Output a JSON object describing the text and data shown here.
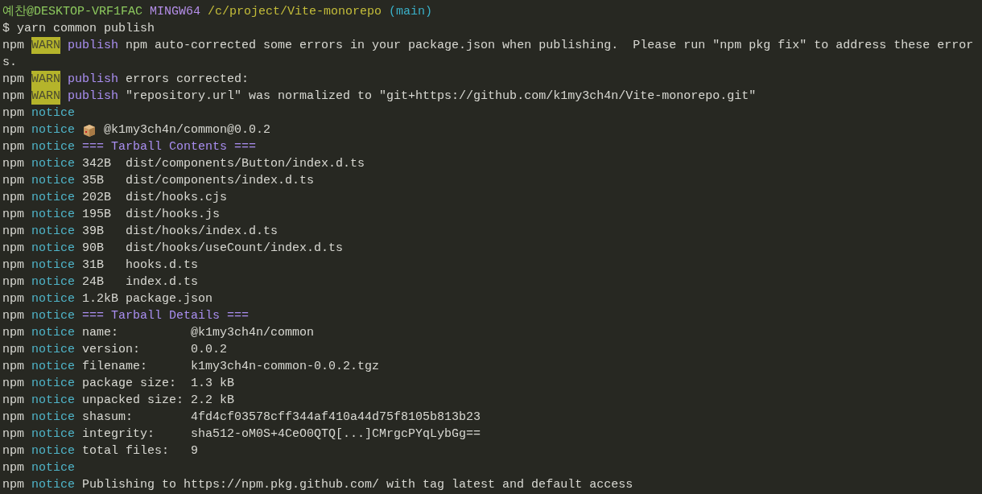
{
  "terminal": {
    "lines": [
      [
        {
          "kind": "user",
          "text": "예찬@DESKTOP-VRF1FAC"
        },
        {
          "kind": "system",
          "text": "MINGW64"
        },
        {
          "kind": "path",
          "text": "/c/project/Vite-monorepo"
        },
        {
          "kind": "branch",
          "text": "(main)"
        }
      ],
      [
        {
          "kind": "prompt",
          "text": "$"
        },
        {
          "kind": "command",
          "text": "yarn common publish"
        }
      ],
      [
        {
          "kind": "prefix",
          "text": "npm"
        },
        {
          "kind": "warn",
          "text": "WARN"
        },
        {
          "kind": "title",
          "text": "publish"
        },
        {
          "kind": "message",
          "text": "npm auto-corrected some errors in your package.json when publishing.  Please run \"npm pkg fix\" to address these error"
        }
      ],
      [
        {
          "kind": "message",
          "text": "s."
        }
      ],
      [
        {
          "kind": "prefix",
          "text": "npm"
        },
        {
          "kind": "warn",
          "text": "WARN"
        },
        {
          "kind": "title",
          "text": "publish"
        },
        {
          "kind": "message",
          "text": "errors corrected:"
        }
      ],
      [
        {
          "kind": "prefix",
          "text": "npm"
        },
        {
          "kind": "warn",
          "text": "WARN"
        },
        {
          "kind": "title",
          "text": "publish"
        },
        {
          "kind": "message",
          "text": "\"repository.url\" was normalized to \"git+https://github.com/k1my3ch4n/Vite-monorepo.git\""
        }
      ],
      [
        {
          "kind": "prefix",
          "text": "npm"
        },
        {
          "kind": "level",
          "text": "notice"
        }
      ],
      [
        {
          "kind": "prefix",
          "text": "npm"
        },
        {
          "kind": "level",
          "text": "notice"
        },
        {
          "kind": "package-icon"
        },
        {
          "kind": "message",
          "text": "@k1my3ch4n/common@0.0.2"
        }
      ],
      [
        {
          "kind": "prefix",
          "text": "npm"
        },
        {
          "kind": "level",
          "text": "notice"
        },
        {
          "kind": "heading",
          "text": "=== Tarball Contents ==="
        }
      ],
      [
        {
          "kind": "prefix",
          "text": "npm"
        },
        {
          "kind": "level",
          "text": "notice"
        },
        {
          "kind": "message",
          "text": "342B  dist/components/Button/index.d.ts"
        }
      ],
      [
        {
          "kind": "prefix",
          "text": "npm"
        },
        {
          "kind": "level",
          "text": "notice"
        },
        {
          "kind": "message",
          "text": "35B   dist/components/index.d.ts"
        }
      ],
      [
        {
          "kind": "prefix",
          "text": "npm"
        },
        {
          "kind": "level",
          "text": "notice"
        },
        {
          "kind": "message",
          "text": "202B  dist/hooks.cjs"
        }
      ],
      [
        {
          "kind": "prefix",
          "text": "npm"
        },
        {
          "kind": "level",
          "text": "notice"
        },
        {
          "kind": "message",
          "text": "195B  dist/hooks.js"
        }
      ],
      [
        {
          "kind": "prefix",
          "text": "npm"
        },
        {
          "kind": "level",
          "text": "notice"
        },
        {
          "kind": "message",
          "text": "39B   dist/hooks/index.d.ts"
        }
      ],
      [
        {
          "kind": "prefix",
          "text": "npm"
        },
        {
          "kind": "level",
          "text": "notice"
        },
        {
          "kind": "message",
          "text": "90B   dist/hooks/useCount/index.d.ts"
        }
      ],
      [
        {
          "kind": "prefix",
          "text": "npm"
        },
        {
          "kind": "level",
          "text": "notice"
        },
        {
          "kind": "message",
          "text": "31B   hooks.d.ts"
        }
      ],
      [
        {
          "kind": "prefix",
          "text": "npm"
        },
        {
          "kind": "level",
          "text": "notice"
        },
        {
          "kind": "message",
          "text": "24B   index.d.ts"
        }
      ],
      [
        {
          "kind": "prefix",
          "text": "npm"
        },
        {
          "kind": "level",
          "text": "notice"
        },
        {
          "kind": "message",
          "text": "1.2kB package.json"
        }
      ],
      [
        {
          "kind": "prefix",
          "text": "npm"
        },
        {
          "kind": "level",
          "text": "notice"
        },
        {
          "kind": "heading",
          "text": "=== Tarball Details ==="
        }
      ],
      [
        {
          "kind": "prefix",
          "text": "npm"
        },
        {
          "kind": "level",
          "text": "notice"
        },
        {
          "kind": "message",
          "text": "name:          @k1my3ch4n/common"
        }
      ],
      [
        {
          "kind": "prefix",
          "text": "npm"
        },
        {
          "kind": "level",
          "text": "notice"
        },
        {
          "kind": "message",
          "text": "version:       0.0.2"
        }
      ],
      [
        {
          "kind": "prefix",
          "text": "npm"
        },
        {
          "kind": "level",
          "text": "notice"
        },
        {
          "kind": "message",
          "text": "filename:      k1my3ch4n-common-0.0.2.tgz"
        }
      ],
      [
        {
          "kind": "prefix",
          "text": "npm"
        },
        {
          "kind": "level",
          "text": "notice"
        },
        {
          "kind": "message",
          "text": "package size:  1.3 kB"
        }
      ],
      [
        {
          "kind": "prefix",
          "text": "npm"
        },
        {
          "kind": "level",
          "text": "notice"
        },
        {
          "kind": "message",
          "text": "unpacked size: 2.2 kB"
        }
      ],
      [
        {
          "kind": "prefix",
          "text": "npm"
        },
        {
          "kind": "level",
          "text": "notice"
        },
        {
          "kind": "message",
          "text": "shasum:        4fd4cf03578cff344af410a44d75f8105b813b23"
        }
      ],
      [
        {
          "kind": "prefix",
          "text": "npm"
        },
        {
          "kind": "level",
          "text": "notice"
        },
        {
          "kind": "message",
          "text": "integrity:     sha512-oM0S+4CeO0QTQ[...]CMrgcPYqLybGg=="
        }
      ],
      [
        {
          "kind": "prefix",
          "text": "npm"
        },
        {
          "kind": "level",
          "text": "notice"
        },
        {
          "kind": "message",
          "text": "total files:   9"
        }
      ],
      [
        {
          "kind": "prefix",
          "text": "npm"
        },
        {
          "kind": "level",
          "text": "notice"
        }
      ],
      [
        {
          "kind": "prefix",
          "text": "npm"
        },
        {
          "kind": "level",
          "text": "notice"
        },
        {
          "kind": "message",
          "text": "Publishing to https://npm.pkg.github.com/ with tag latest and default access"
        }
      ]
    ]
  }
}
